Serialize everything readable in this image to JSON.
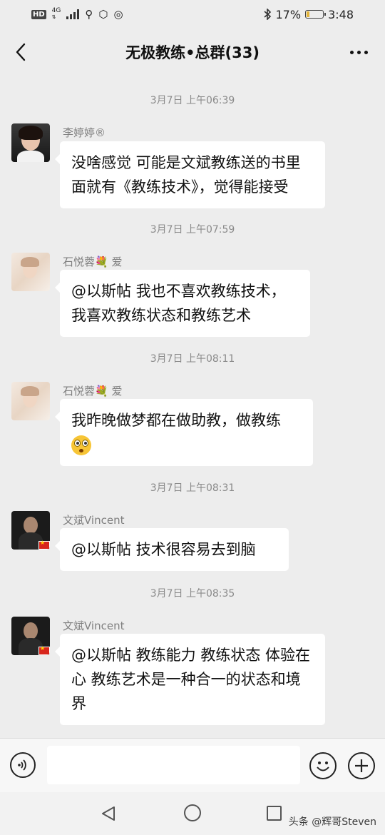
{
  "status_bar": {
    "hd": "HD",
    "network": "4G",
    "battery_text": "17%",
    "battery_level": 0.17,
    "time": "3:48"
  },
  "header": {
    "title": "无极教练•总群(33)"
  },
  "messages": [
    {
      "timestamp": "3月7日 上午06:39",
      "sender": "李婷婷®",
      "text": "没啥感觉 可能是文斌教练送的书里面就有《教练技术》，觉得能接受"
    },
    {
      "timestamp": "3月7日 上午07:59",
      "sender": "石悦蓉💐 爱",
      "text": "@以斯帖  我也不喜欢教练技术，我喜欢教练状态和教练艺术"
    },
    {
      "timestamp": "3月7日 上午08:11",
      "sender": "石悦蓉💐 爱",
      "text": "我昨晚做梦都在做助教，做教练",
      "emoji": "flushed-face-emoji"
    },
    {
      "timestamp": "3月7日 上午08:31",
      "sender": "文斌Vincent",
      "text": "@以斯帖  技术很容易去到脑"
    },
    {
      "timestamp": "3月7日 上午08:35",
      "sender": "文斌Vincent",
      "text": "@以斯帖  教练能力 教练状态 体验在心 教练艺术是一种合一的状态和境界"
    }
  ],
  "input_bar": {
    "placeholder": ""
  },
  "watermark": "头条 @辉哥Steven",
  "colors": {
    "background": "#ededed",
    "bubble": "#ffffff",
    "timestamp": "#8a8a8a",
    "sender": "#7f7f7f"
  }
}
